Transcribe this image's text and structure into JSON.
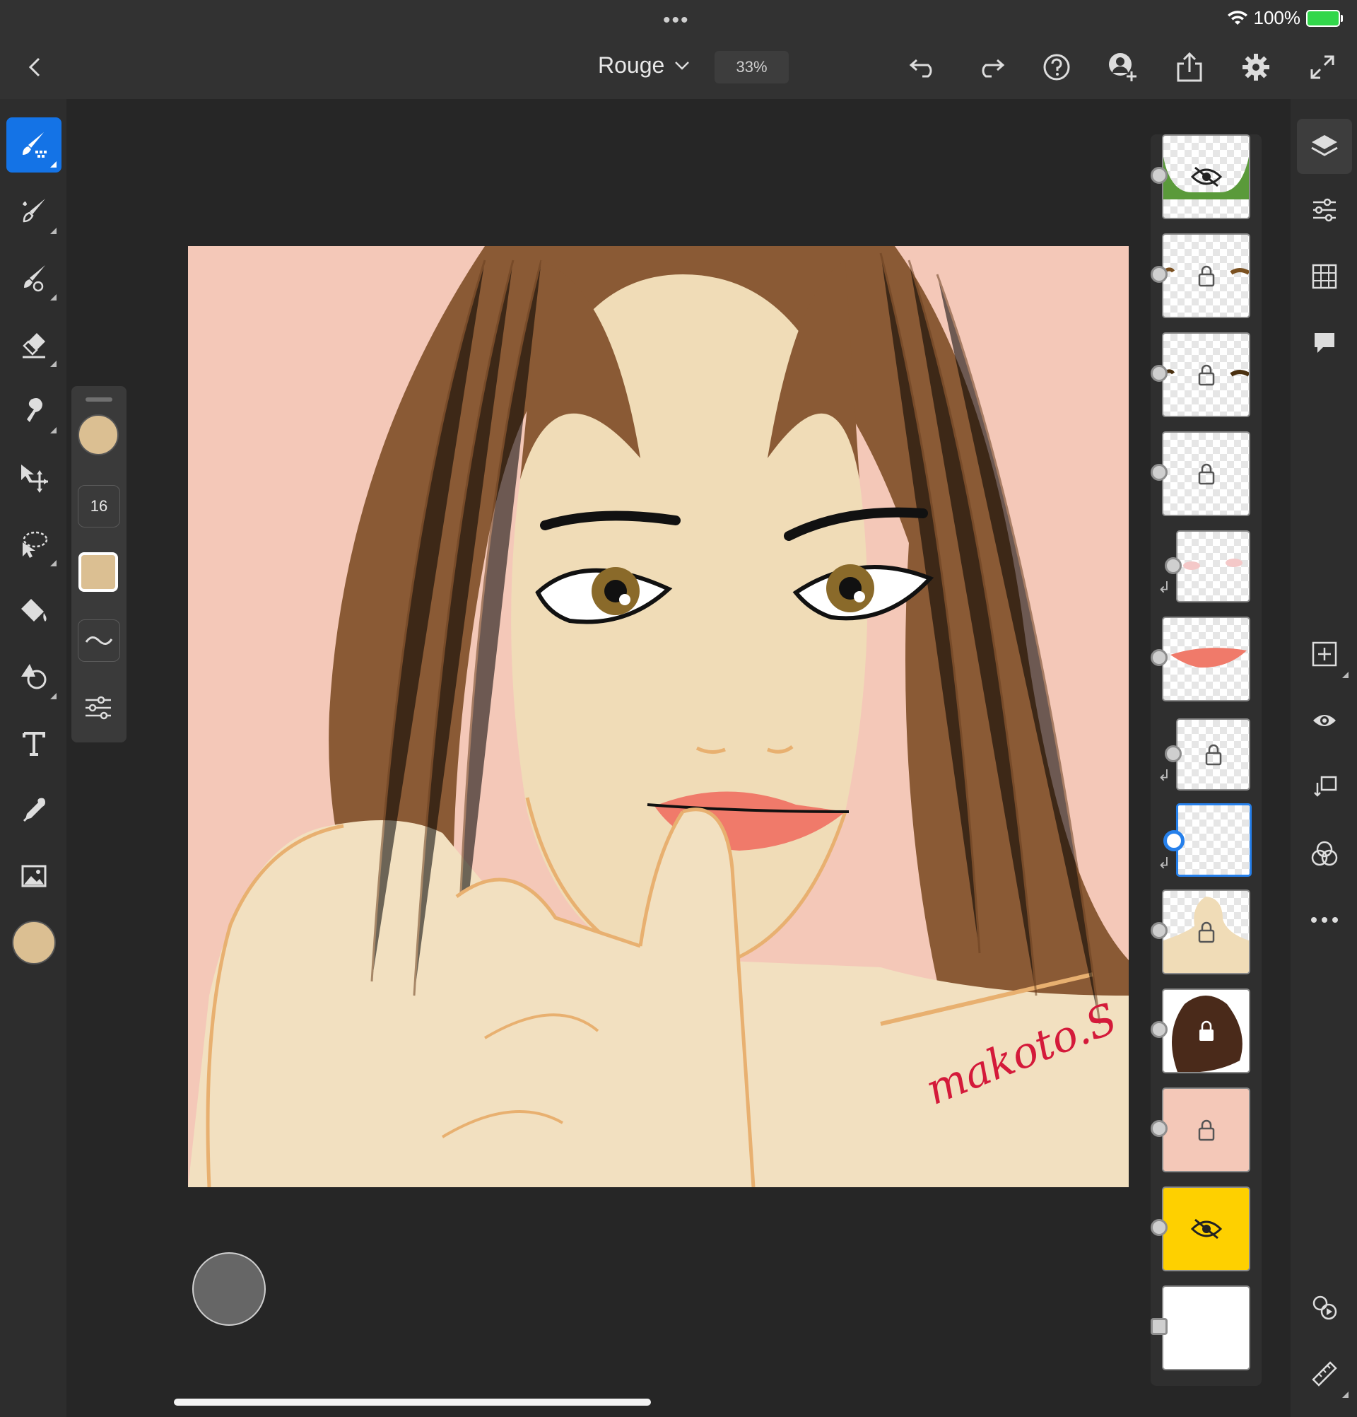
{
  "status": {
    "battery": "100%",
    "dots": "•••"
  },
  "toolbar": {
    "document_name": "Rouge",
    "zoom": "33%"
  },
  "left_tools": [
    "pixel-brush",
    "paint-brush",
    "mixer-brush",
    "eraser",
    "smudge",
    "move",
    "lasso",
    "fill",
    "shape",
    "text",
    "eyedropper",
    "image",
    "color"
  ],
  "brush_properties": {
    "color": "#dbbf92",
    "size": "16",
    "swatch": "#dbbf92"
  },
  "artwork": {
    "signature": "makoto.S",
    "background": "#f4c8b8"
  },
  "layers": [
    {
      "name": "layer-leaves",
      "hidden": true,
      "locked": false
    },
    {
      "name": "layer-brows-1",
      "hidden": false,
      "locked": true
    },
    {
      "name": "layer-brows-2",
      "hidden": false,
      "locked": true
    },
    {
      "name": "layer-empty",
      "hidden": false,
      "locked": true
    },
    {
      "name": "layer-blush",
      "hidden": false,
      "locked": false,
      "clipped": true
    },
    {
      "name": "layer-lips",
      "hidden": false,
      "locked": false
    },
    {
      "name": "layer-clip-locked",
      "hidden": false,
      "locked": true,
      "clipped": true
    },
    {
      "name": "layer-selected",
      "hidden": false,
      "locked": false,
      "clipped": true,
      "selected": true
    },
    {
      "name": "layer-skin",
      "hidden": false,
      "locked": true
    },
    {
      "name": "layer-hair",
      "hidden": false,
      "locked": true
    },
    {
      "name": "layer-pink-bg",
      "hidden": false,
      "locked": true
    },
    {
      "name": "layer-yellow",
      "hidden": true,
      "locked": false
    },
    {
      "name": "layer-white-image",
      "hidden": false,
      "locked": false
    }
  ],
  "colors": {
    "accent": "#1473e6",
    "panel": "#2d2d2d"
  }
}
